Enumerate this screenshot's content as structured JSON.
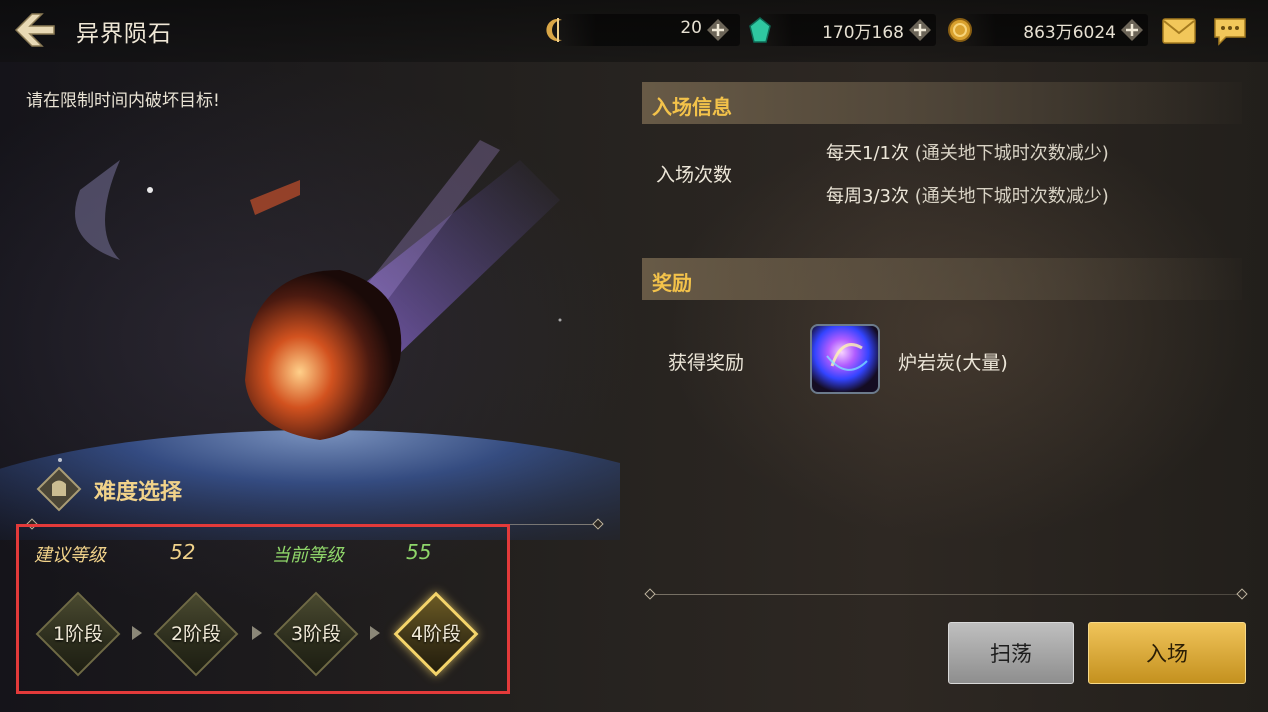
{
  "header": {
    "title": "异界陨石",
    "currencies": [
      {
        "icon": "crescent-currency-icon",
        "value": "20"
      },
      {
        "icon": "green-crystal-icon",
        "value": "170万168"
      },
      {
        "icon": "gold-coin-icon",
        "value": "863万6024"
      }
    ]
  },
  "objective": "请在限制时间内破坏目标!",
  "entry_info": {
    "title": "入场信息",
    "label": "入场次数",
    "lines": [
      {
        "count": "每天1/1次",
        "note": "(通关地下城时次数减少)"
      },
      {
        "count": "每周3/3次",
        "note": "(通关地下城时次数减少)"
      }
    ]
  },
  "reward": {
    "title": "奖励",
    "label": "获得奖励",
    "item_name": "炉岩炭(大量)",
    "item_icon": "lava-charcoal-orb-icon"
  },
  "difficulty": {
    "title": "难度选择",
    "recommended_label": "建议等级",
    "recommended_value": "52",
    "current_label": "当前等级",
    "current_value": "55",
    "stages": [
      "1阶段",
      "2阶段",
      "3阶段",
      "4阶段"
    ],
    "selected_stage": 4
  },
  "buttons": {
    "sweep": "扫荡",
    "enter": "入场"
  },
  "colors": {
    "accent_gold": "#f3c24a",
    "recommended_color": "#f1d28a",
    "current_color": "#8fd66a",
    "highlight_box": "#e33a3a"
  }
}
